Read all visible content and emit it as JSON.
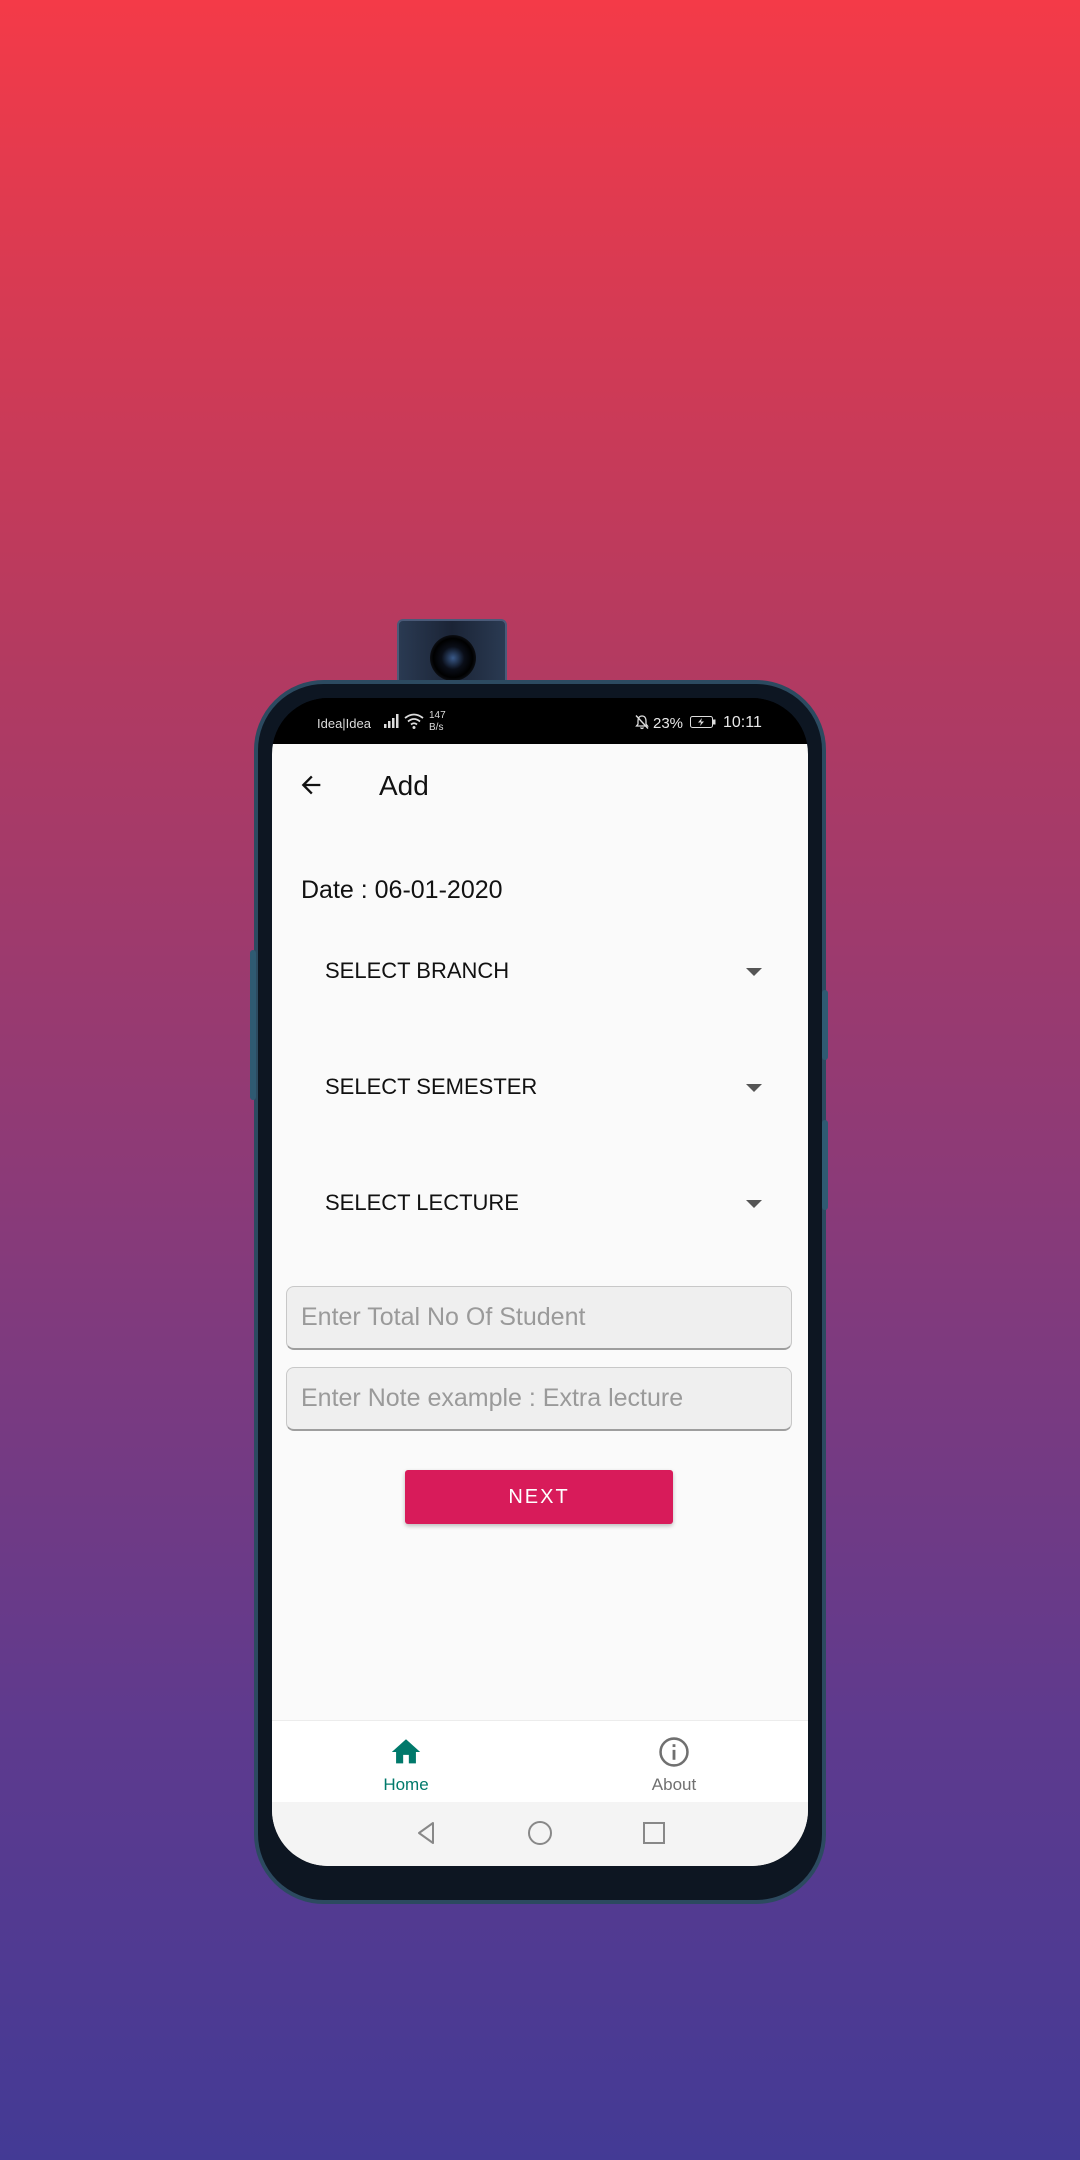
{
  "status_bar": {
    "carrier": "Idea|Idea",
    "speed_value": "147",
    "speed_unit": "B/s",
    "battery_percent": "23%",
    "time": "10:11",
    "icons": [
      "signal-icon",
      "wifi-icon",
      "mute-icon",
      "battery-icon"
    ]
  },
  "toolbar": {
    "title": "Add",
    "back_icon": "arrow-left-icon"
  },
  "form": {
    "date_label": "Date : 06-01-2020",
    "dropdowns": [
      {
        "label": "SELECT BRANCH"
      },
      {
        "label": "SELECT SEMESTER"
      },
      {
        "label": "SELECT LECTURE"
      }
    ],
    "students_placeholder": "Enter Total No Of Student",
    "note_placeholder": "Enter Note example : Extra lecture",
    "next_label": "NEXT"
  },
  "bottom_nav": {
    "items": [
      {
        "label": "Home",
        "icon": "home-icon",
        "active": true
      },
      {
        "label": "About",
        "icon": "info-icon",
        "active": false
      }
    ],
    "active_color": "#00796b"
  },
  "colors": {
    "accent": "#d81b5a",
    "nav_active": "#00796b"
  }
}
